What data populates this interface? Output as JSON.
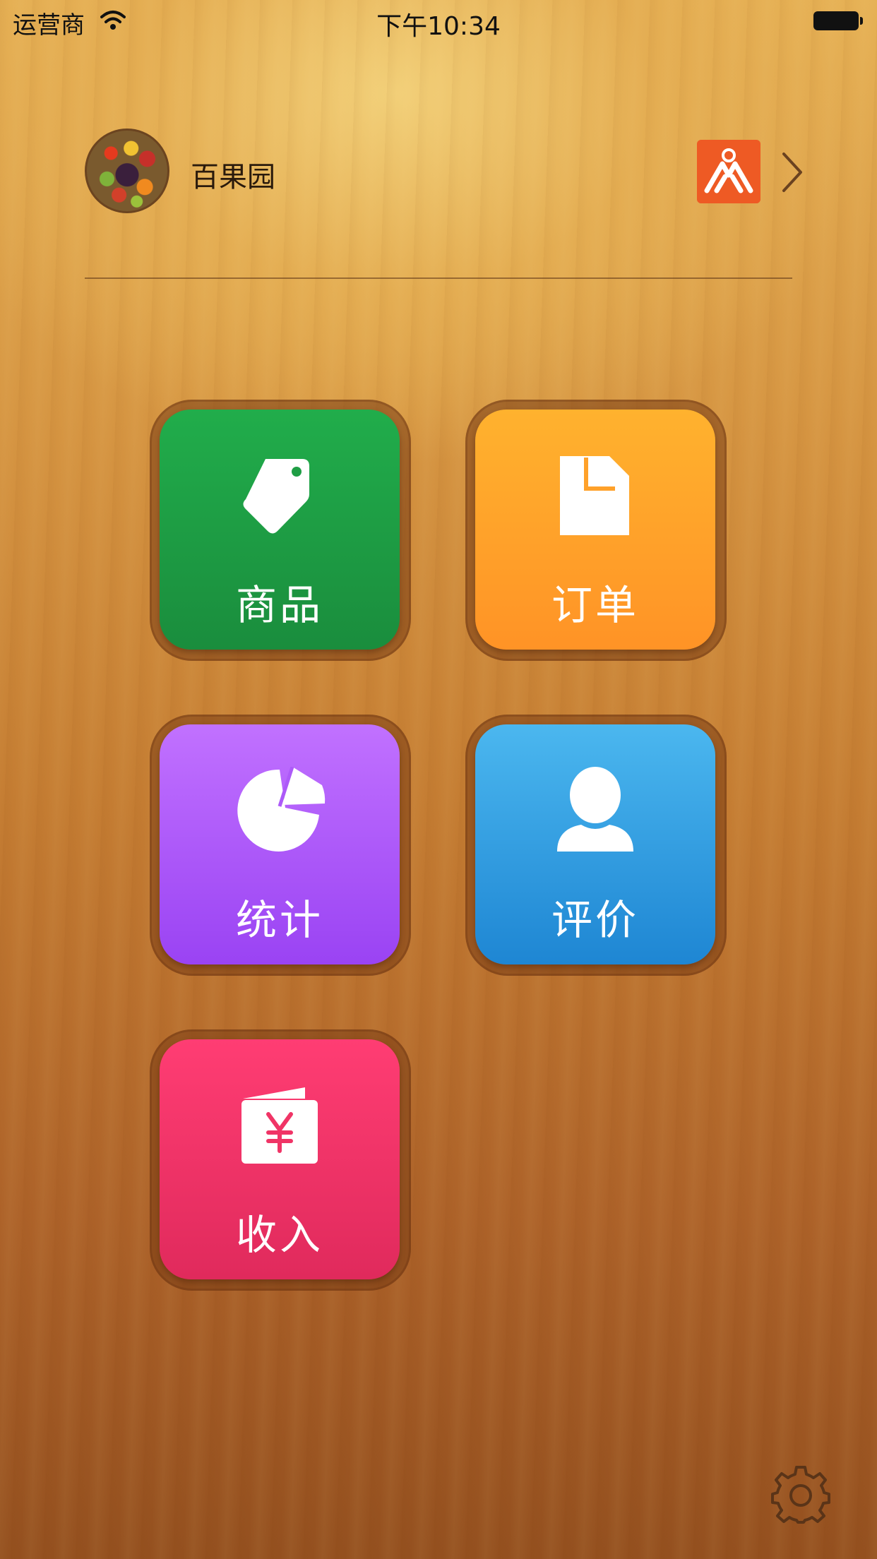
{
  "status_bar": {
    "carrier": "运营商",
    "time": "下午10:34"
  },
  "header": {
    "store_name": "百果园"
  },
  "tiles": [
    {
      "label": "商品",
      "icon": "tag-icon",
      "color": "#1f9e45"
    },
    {
      "label": "订单",
      "icon": "document-icon",
      "color": "#ffa12a"
    },
    {
      "label": "统计",
      "icon": "pie-chart-icon",
      "color": "#ad5af8"
    },
    {
      "label": "评价",
      "icon": "user-icon",
      "color": "#35a0e2"
    },
    {
      "label": "收入",
      "icon": "wallet-yuan-icon",
      "color": "#f03466"
    }
  ],
  "footer": {
    "settings_icon": "gear-icon"
  }
}
